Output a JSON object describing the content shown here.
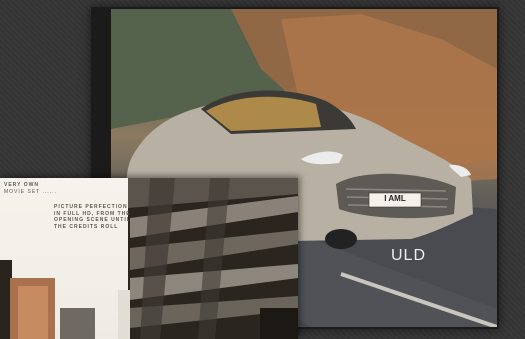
{
  "main_card": {
    "headline": "ULD",
    "license_plate": "I AML"
  },
  "brochure": {
    "caption_a_line1": "VERY OWN",
    "caption_a_line2": "MOVIE SET ......",
    "caption_b_line1": "PICTURE PERFECTION",
    "caption_b_line2": "IN FULL HD, FROM THE",
    "caption_b_line3": "OPENING SCENE UNTIL",
    "caption_b_line4": "THE CREDITS ROLL"
  },
  "colors": {
    "background": "#3a3a3a",
    "card_border": "#1b1b1b",
    "car_silver": "#b7b0a3",
    "brochure_paper": "#f4f1ec"
  }
}
